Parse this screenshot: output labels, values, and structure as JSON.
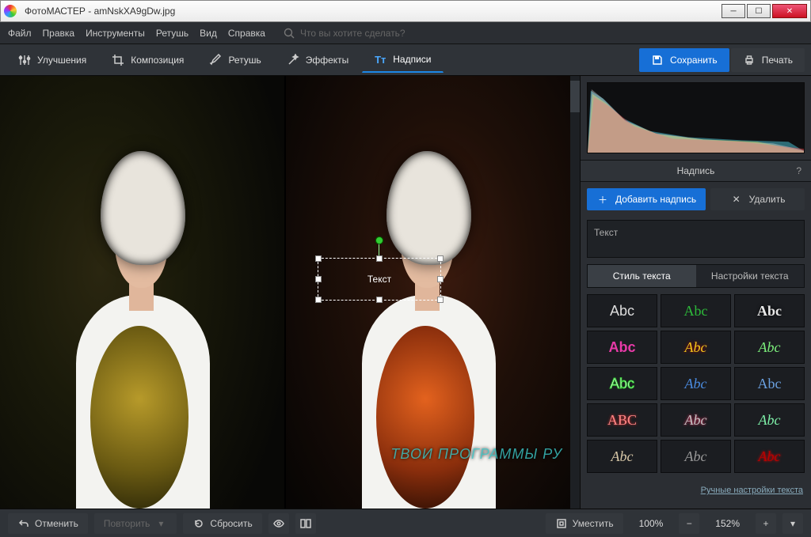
{
  "titlebar": {
    "title": "ФотоМАСТЕР - amNskXA9gDw.jpg"
  },
  "menu": {
    "items": [
      "Файл",
      "Правка",
      "Инструменты",
      "Ретушь",
      "Вид",
      "Справка"
    ],
    "search_placeholder": "Что вы хотите сделать?"
  },
  "toolbar": {
    "improve": "Улучшения",
    "composition": "Композиция",
    "retouch": "Ретушь",
    "effects": "Эффекты",
    "captions": "Надписи",
    "save": "Сохранить",
    "print": "Печать"
  },
  "canvas": {
    "text_overlay": "Текст"
  },
  "rpanel": {
    "section_title": "Надпись",
    "help_mark": "?",
    "add_caption": "Добавить надпись",
    "delete": "Удалить",
    "text_value": "Текст",
    "tab_style": "Стиль текста",
    "tab_settings": "Настройки текста",
    "styles": [
      {
        "label": "Abc",
        "css": "color:#ddd;font-family:Arial;"
      },
      {
        "label": "Abc",
        "css": "color:#2dbb3a;font-family:Georgia;"
      },
      {
        "label": "Abc",
        "css": "color:#e8e8e8;font-weight:bold;text-shadow:0 0 4px #000;font-family:Arial Black;"
      },
      {
        "label": "Abc",
        "css": "color:#e83aa8;font-weight:bold;font-family:Arial;"
      },
      {
        "label": "Abc",
        "css": "color:#f4c81a;font-family:Georgia;font-style:italic;text-shadow:0 0 4px #a00;"
      },
      {
        "label": "Abc",
        "css": "color:#7cf07c;font-family:Georgia;font-style:italic;"
      },
      {
        "label": "Abc",
        "css": "color:#fff;-webkit-text-stroke:1px #3c3;font-family:Arial;"
      },
      {
        "label": "Abc",
        "css": "color:#4a8be0;font-style:italic;font-family:Georgia;"
      },
      {
        "label": "Abc",
        "css": "color:#6aa0e0;font-family:Georgia;"
      },
      {
        "label": "ABC",
        "css": "color:#f88;font-family:Arial Black;text-shadow:0 0 3px #f33;"
      },
      {
        "label": "Abc",
        "css": "color:#c3c3c3;font-family:Georgia;font-style:italic;text-shadow:0 0 3px #f36;"
      },
      {
        "label": "Abc",
        "css": "color:#7ef0a8;font-family:'Brush Script MT',cursive;font-style:italic;"
      },
      {
        "label": "Abc",
        "css": "color:#d8c8a8;font-family:'Brush Script MT',cursive;font-style:italic;"
      },
      {
        "label": "Abc",
        "css": "color:#999;font-family:'Brush Script MT',cursive;font-style:italic;"
      },
      {
        "label": "Abc",
        "css": "color:#b00;font-family:Georgia;font-style:italic;text-shadow:0 0 3px #f00;"
      }
    ],
    "manual_link": "Ручные настройки текста"
  },
  "bottombar": {
    "undo": "Отменить",
    "redo": "Повторить",
    "reset": "Сбросить",
    "fit": "Уместить",
    "zoom_original": "100%",
    "zoom_current": "152%"
  },
  "watermark": "ТВОИ ПРОГРАММЫ РУ"
}
